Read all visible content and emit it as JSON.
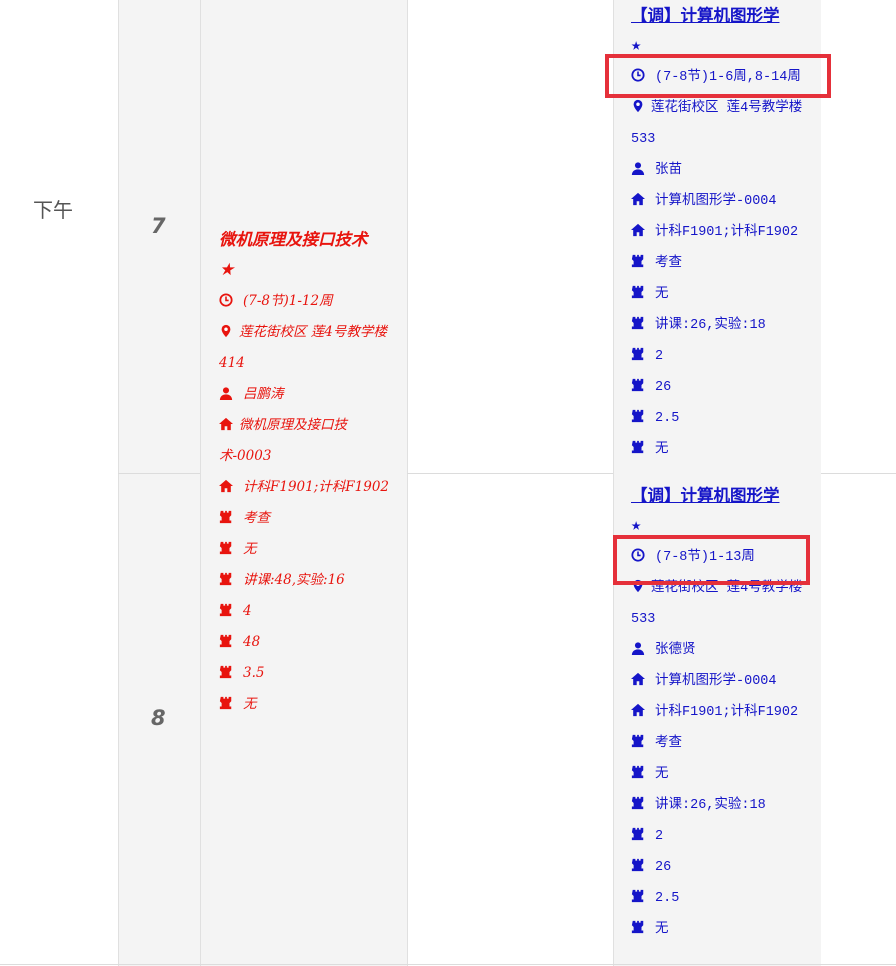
{
  "period": "下午",
  "sections": [
    "7",
    "8"
  ],
  "course_red": {
    "title": "微机原理及接口技术",
    "star": "★",
    "time": "(7-8节)1-12周",
    "location": "莲花街校区 莲4号教学楼414",
    "teacher": "吕鹏涛",
    "class_code": "微机原理及接口技术-0003",
    "classes": "计科F1901;计科F1902",
    "assessment": "考查",
    "extra1": "无",
    "hours": "讲课:48,实验:16",
    "val1": "4",
    "val2": "48",
    "credits": "3.5",
    "extra2": "无"
  },
  "course_blue_1": {
    "title": "【调】计算机图形学",
    "star": "★",
    "time": "(7-8节)1-6周,8-14周",
    "location": "莲花街校区 莲4号教学楼533",
    "teacher": "张苗",
    "class_code": "计算机图形学-0004",
    "classes": "计科F1901;计科F1902",
    "assessment": "考查",
    "extra1": "无",
    "hours": "讲课:26,实验:18",
    "val1": "2",
    "val2": "26",
    "credits": "2.5",
    "extra2": "无"
  },
  "course_blue_2": {
    "title": "【调】计算机图形学",
    "star": "★",
    "time": "(7-8节)1-13周",
    "location": "莲花街校区 莲4号教学楼533",
    "teacher": "张德贤",
    "class_code": "计算机图形学-0004",
    "classes": "计科F1901;计科F1902",
    "assessment": "考查",
    "extra1": "无",
    "hours": "讲课:26,实验:18",
    "val1": "2",
    "val2": "26",
    "credits": "2.5",
    "extra2": "无"
  },
  "colors": {
    "red": "#e8140e",
    "blue": "#1515c8",
    "highlight": "#e5303a"
  }
}
